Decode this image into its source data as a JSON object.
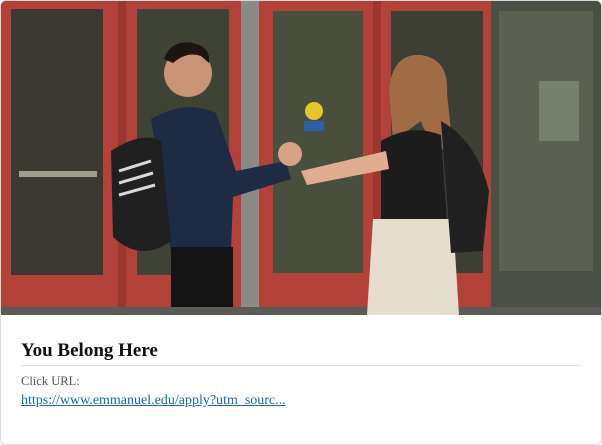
{
  "card": {
    "headline": "You Belong Here",
    "url_label": "Click URL:",
    "url_text": "https://www.emmanuel.edu/apply?utm_sourc...",
    "image_alt": "Two students shaking hands in front of red doors"
  },
  "colors": {
    "link": "#1a66c2",
    "headline": "#111111",
    "door_red": "#b2413a"
  }
}
